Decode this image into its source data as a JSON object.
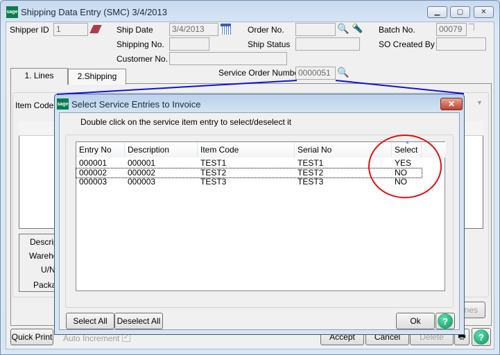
{
  "window": {
    "title": "Shipping Data Entry (SMC) 3/4/2013",
    "logo": "sage"
  },
  "header": {
    "shipper_id": {
      "label": "Shipper ID",
      "value": "1"
    },
    "ship_date": {
      "label": "Ship Date",
      "value": "3/4/2013"
    },
    "order_no": {
      "label": "Order No.",
      "value": ""
    },
    "batch_no": {
      "label": "Batch No.",
      "value": "00079"
    },
    "shipping_no": {
      "label": "Shipping No.",
      "value": ""
    },
    "ship_status": {
      "label": "Ship Status",
      "value": ""
    },
    "so_created_by": {
      "label": "SO Created By",
      "value": ""
    },
    "customer_no": {
      "label": "Customer No.",
      "value": ""
    },
    "service_order_number": {
      "label": "Service Order Number",
      "value": "0000051"
    }
  },
  "tabs": [
    {
      "label": "1. Lines",
      "active": true
    },
    {
      "label": "2.Shipping",
      "active": false
    }
  ],
  "lines": {
    "item_code_label": "Item Code",
    "detail_labels": [
      "Descrip",
      "Wareho",
      "U/N",
      "Packa"
    ],
    "lines_button": "nes"
  },
  "footer": {
    "quick_print": "Quick Print",
    "auto_increment": "Auto Increment",
    "auto_increment_checked": true,
    "accept": "Accept",
    "cancel": "Cancel",
    "delete": "Delete"
  },
  "dialog": {
    "title": "Select Service Entries to Invoice",
    "instruction": "Double click on the service item entry to select/deselect it",
    "columns": [
      "Entry No",
      "Description",
      "Item Code",
      "Serial No",
      "Select"
    ],
    "rows": [
      [
        "000001",
        "000001",
        "TEST1",
        "TEST1",
        "YES"
      ],
      [
        "000002",
        "000002",
        "TEST2",
        "TEST2",
        "NO"
      ],
      [
        "000003",
        "000003",
        "TEST3",
        "TEST3",
        "NO"
      ]
    ],
    "focused_row": 1,
    "select_all": "Select All",
    "deselect_all": "Deselect All",
    "ok": "Ok"
  },
  "annotation": {
    "highlight_color": "#e01010",
    "callout_color": "#1010e0"
  }
}
